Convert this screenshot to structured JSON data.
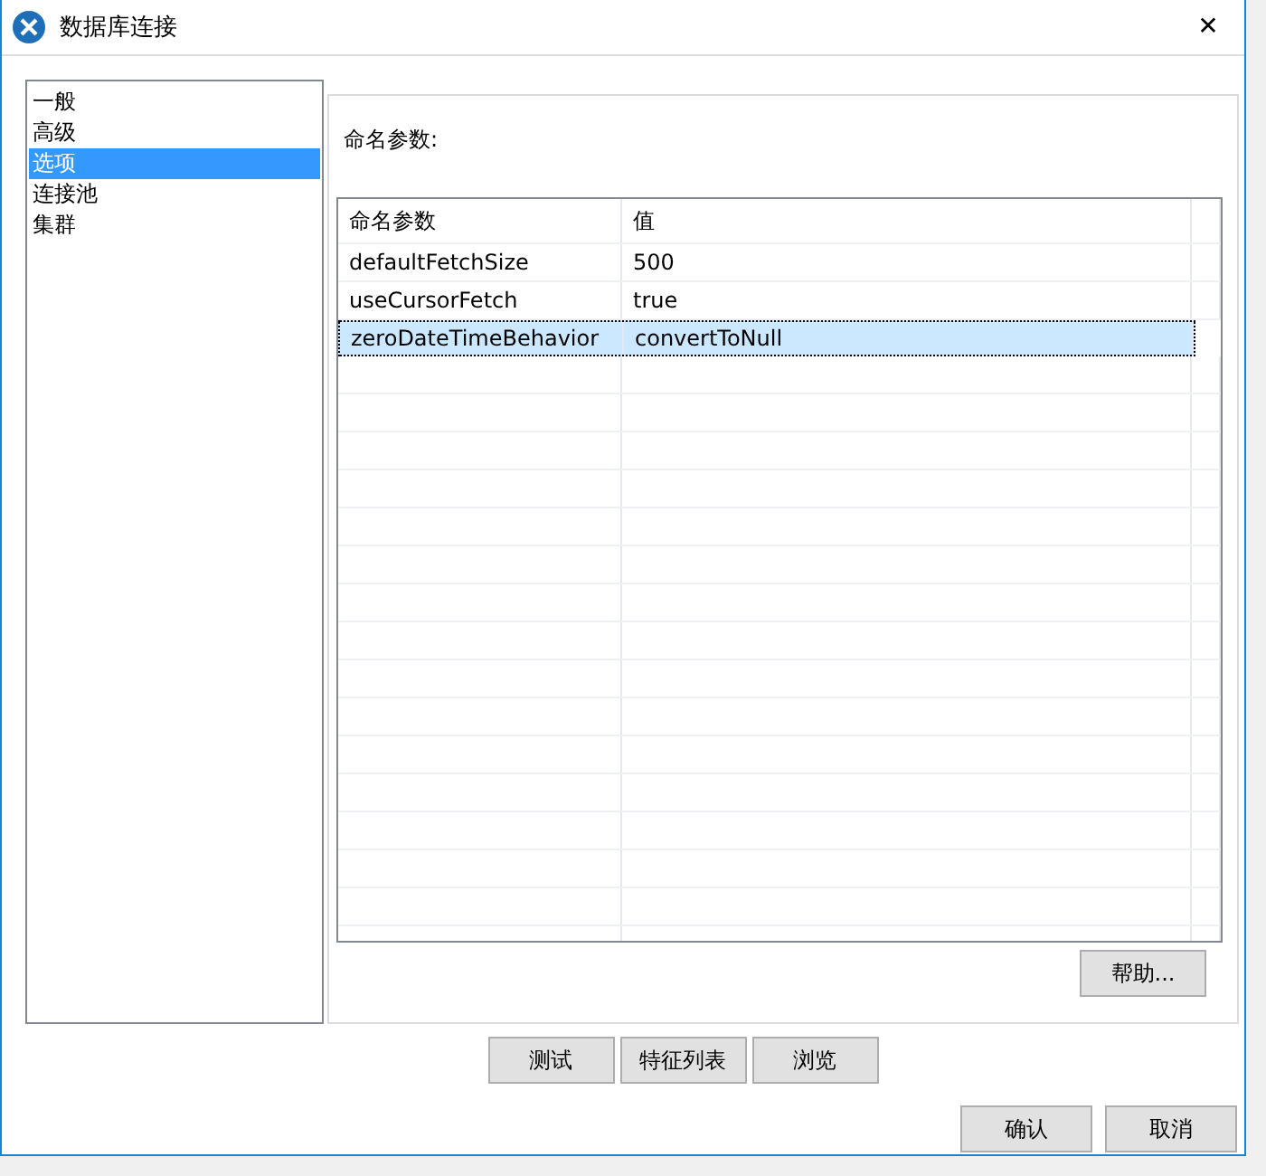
{
  "window": {
    "title": "数据库连接",
    "close": "✕"
  },
  "sidebar": {
    "items": [
      {
        "label": "一般",
        "selected": false
      },
      {
        "label": "高级",
        "selected": false
      },
      {
        "label": "选项",
        "selected": true
      },
      {
        "label": "连接池",
        "selected": false
      },
      {
        "label": "集群",
        "selected": false
      }
    ]
  },
  "panel": {
    "label": "命名参数:",
    "table": {
      "columns": [
        "命名参数",
        "值"
      ],
      "rows": [
        {
          "cells": [
            "defaultFetchSize",
            "500"
          ],
          "selected": false
        },
        {
          "cells": [
            "useCursorFetch",
            "true"
          ],
          "selected": false
        },
        {
          "cells": [
            "zeroDateTimeBehavior",
            "convertToNull"
          ],
          "selected": true
        }
      ]
    },
    "help_button": "帮助..."
  },
  "action_buttons": [
    "测试",
    "特征列表",
    "浏览"
  ],
  "dialog_buttons": [
    "确认",
    "取消"
  ]
}
